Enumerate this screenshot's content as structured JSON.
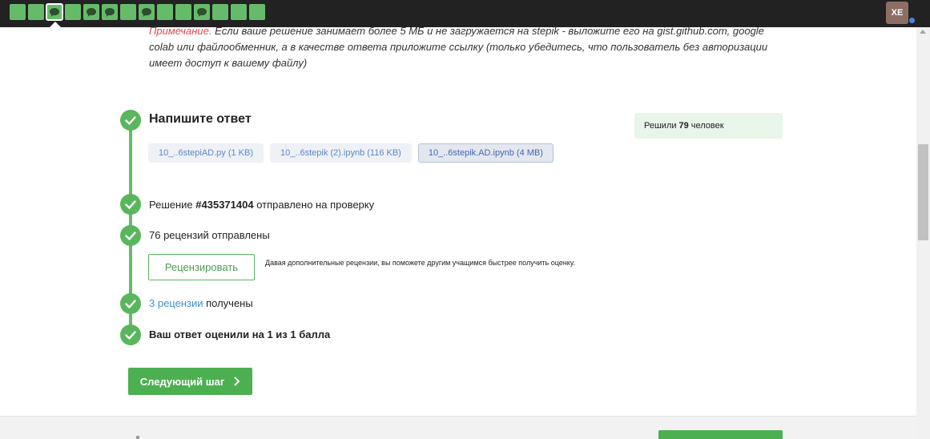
{
  "topbar": {
    "steps": [
      {
        "icon": "empty"
      },
      {
        "icon": "empty"
      },
      {
        "icon": "comment-icon"
      },
      {
        "icon": "empty"
      },
      {
        "icon": "comment-icon"
      },
      {
        "icon": "comment-icon"
      },
      {
        "icon": "empty"
      },
      {
        "icon": "comment-icon"
      },
      {
        "icon": "empty"
      },
      {
        "icon": "empty"
      },
      {
        "icon": "comment-icon"
      },
      {
        "icon": "empty"
      },
      {
        "icon": "empty"
      },
      {
        "icon": "empty"
      }
    ],
    "current_step": 3,
    "avatar_initials": "XE"
  },
  "note": {
    "label": "Примечание.",
    "text": " Если ваше решение занимает более 5 МБ и не загружается на stepik - выложите его на gist.github.com, google colab или файлообменник, а в качестве ответа приложите ссылку (только убедитесь, что пользователь без авторизации имеет доступ к вашему файлу)"
  },
  "answer": {
    "heading": "Напишите ответ",
    "solved_prefix": "Решили",
    "solved_count": "79",
    "solved_suffix": "человек",
    "files": [
      {
        "name": "10_..6stepiAD.py (1 KB)",
        "active": false
      },
      {
        "name": "10_..6stepik (2).ipynb (116 KB)",
        "active": false
      },
      {
        "name": "10_..6stepik.AD.ipynb (4 MB)",
        "active": true
      }
    ]
  },
  "status": {
    "submitted_prefix": "Решение ",
    "submission_id": "#435371404",
    "submitted_suffix": " отправлено на проверку",
    "reviews_sent": "76 рецензий отправлены",
    "review_button": "Рецензировать",
    "review_hint": "Давая дополнительные рецензии, вы поможете другим учащимся быстрее получить оценку.",
    "reviews_received_link": "3 рецензии",
    "reviews_received_suffix": " получены",
    "score_text": "Ваш ответ оценили на 1 из 1 балла"
  },
  "next_button": "Следующий шаг",
  "colors": {
    "accent_green": "#4caf50",
    "note_label_red": "#e5484d",
    "link_blue": "#3f8fd3"
  }
}
